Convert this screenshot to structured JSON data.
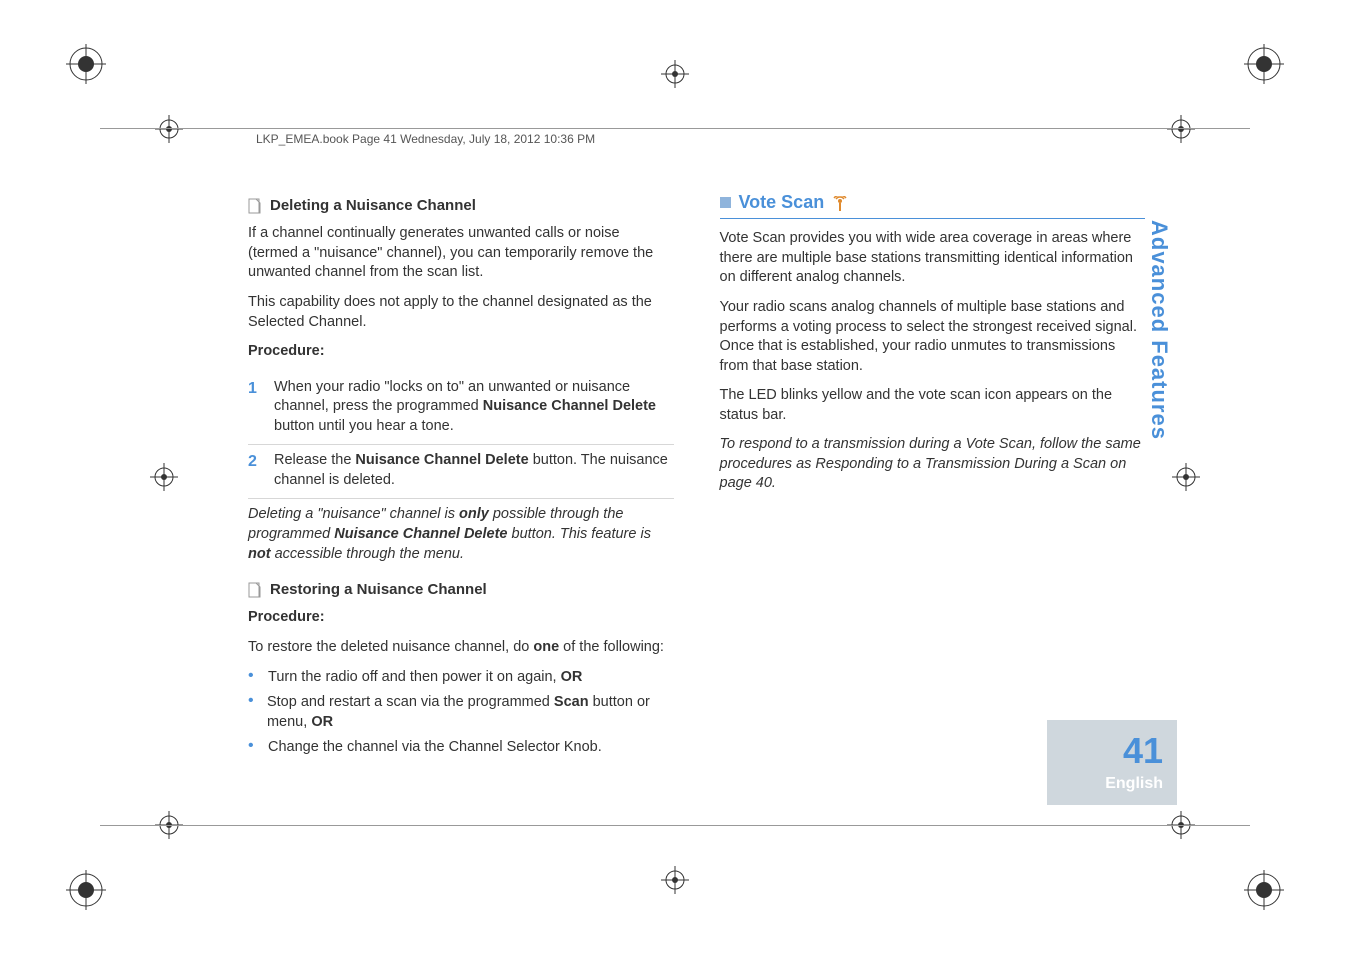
{
  "header_line": "LKP_EMEA.book  Page 41  Wednesday, July 18, 2012  10:36 PM",
  "left": {
    "h1": "Deleting a Nuisance Channel",
    "p1": "If a channel continually generates unwanted calls or noise (termed a \"nuisance\" channel), you can temporarily remove the unwanted channel from the scan list.",
    "p2": "This capability does not apply to the channel designated as the Selected Channel.",
    "proc_label": "Procedure:",
    "steps": [
      {
        "n": "1",
        "pre": "When your radio \"locks on to\" an unwanted or nuisance channel, press the programmed ",
        "bold": "Nuisance Channel Delete",
        "post": " button until you hear a tone."
      },
      {
        "n": "2",
        "pre": "Release the ",
        "bold": "Nuisance Channel Delete",
        "post": " button. The nuisance channel is deleted."
      }
    ],
    "note_pre": "Deleting a \"nuisance\" channel is ",
    "note_only": "only",
    "note_mid": " possible through the programmed ",
    "note_btn": "Nuisance Channel Delete",
    "note_mid2": " button. This feature is ",
    "note_not": "not",
    "note_post": " accessible through the menu.",
    "h2": "Restoring a Nuisance Channel",
    "proc_label2": "Procedure:",
    "restore_intro_pre": "To restore the deleted nuisance channel, do ",
    "restore_intro_bold": "one",
    "restore_intro_post": " of the following:",
    "bullets": [
      {
        "pre": "Turn the radio off and then power it on again, ",
        "bold": "OR",
        "post": ""
      },
      {
        "pre": "Stop and restart a scan via the programmed ",
        "bold": "Scan",
        "post": " button or menu, ",
        "bold2": "OR"
      },
      {
        "pre": "Change the channel via the Channel Selector Knob.",
        "bold": "",
        "post": ""
      }
    ]
  },
  "right": {
    "title": "Vote Scan",
    "p1": "Vote Scan provides you with wide area coverage in areas where there are multiple base stations transmitting identical information on different analog channels.",
    "p2": "Your radio scans analog channels of multiple base stations and performs a voting process to select the strongest received signal. Once that is established, your radio unmutes to transmissions from that base station.",
    "p3": "The LED blinks yellow and the vote scan icon appears on the status bar.",
    "note": "To respond to a transmission during a Vote Scan, follow the same procedures as Responding to a Transmission During a Scan on page 40."
  },
  "side": {
    "label": "Advanced Features",
    "page": "41",
    "lang": "English"
  }
}
